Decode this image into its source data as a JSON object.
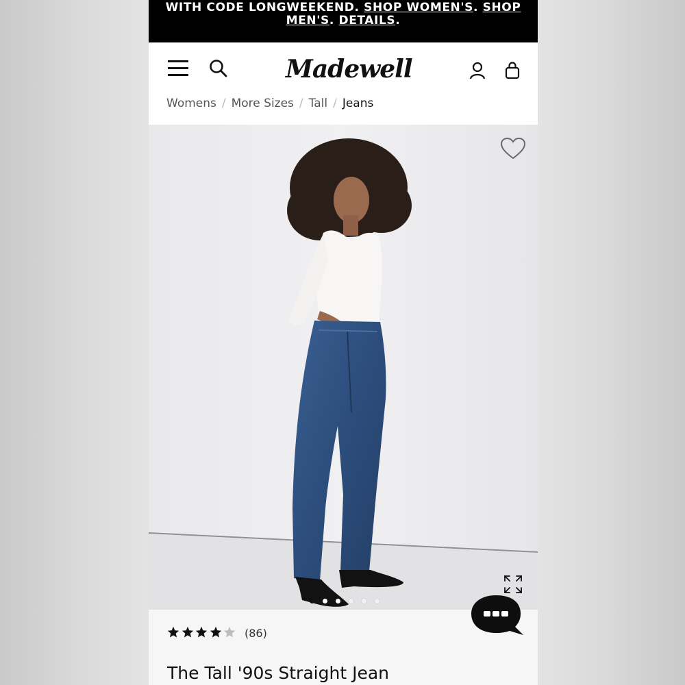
{
  "promo": {
    "text_prefix": "WITH CODE LONGWEEKEND.",
    "shop_womens": "SHOP WOMEN'S",
    "dot1": ".",
    "shop_mens_part1": "SHOP",
    "shop_mens_part2": "MEN'S",
    "dot2": ".",
    "details": "DETAILS",
    "dot3": "."
  },
  "header": {
    "logo_text": "Madewell",
    "icons": [
      "menu-icon",
      "search-icon",
      "account-icon",
      "bag-icon"
    ]
  },
  "breadcrumb": {
    "items": [
      "Womens",
      "More Sizes",
      "Tall",
      "Jeans"
    ],
    "separator": "/"
  },
  "gallery": {
    "slide_count": 6,
    "active_slide": 1,
    "icons": [
      "heart-icon",
      "expand-icon"
    ]
  },
  "product": {
    "rating": 4,
    "rating_max": 5,
    "review_count": "(86)",
    "title": "The Tall '90s Straight Jean"
  },
  "chat": {
    "icon": "chat-bubble-icon"
  },
  "colors": {
    "banner_bg": "#000000",
    "star_filled": "#111111",
    "star_empty": "#bdbdbd",
    "chat_bg": "#0e0e0e"
  }
}
